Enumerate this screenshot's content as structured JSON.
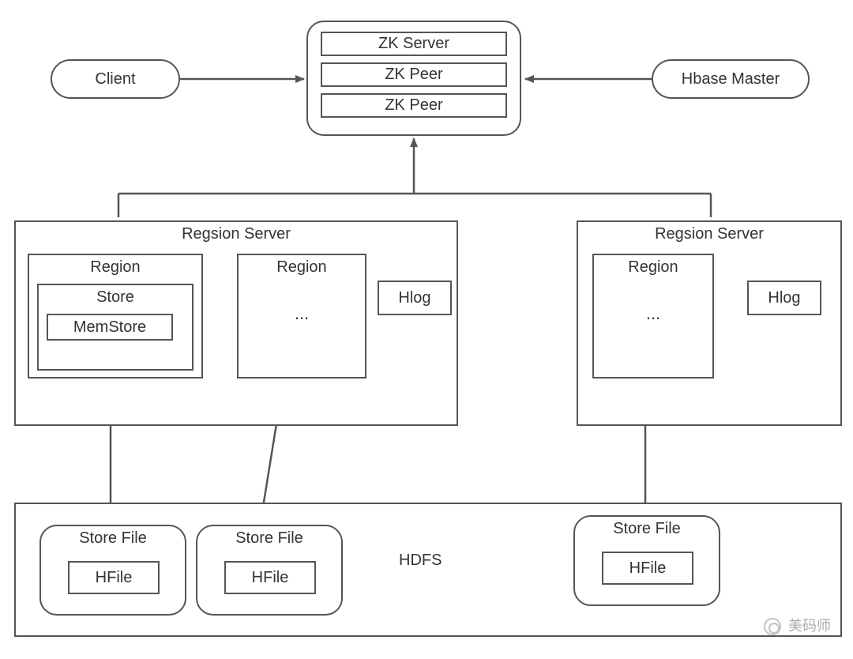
{
  "client": "Client",
  "hbase_master": "Hbase Master",
  "zk_cluster": {
    "items": [
      "ZK Server",
      "ZK Peer",
      "ZK Peer"
    ]
  },
  "region_server_1": {
    "title": "Regsion Server",
    "region_full": {
      "title": "Region",
      "store": "Store",
      "memstore": "MemStore"
    },
    "region_ellipsis": {
      "title": "Region",
      "body": "..."
    },
    "hlog": "Hlog"
  },
  "region_server_2": {
    "title": "Regsion Server",
    "region_ellipsis": {
      "body": "..."
    },
    "hlog": "Hlog"
  },
  "hdfs": {
    "label": "HDFS",
    "store_files": [
      {
        "title": "Store File",
        "hfile": "HFile"
      },
      {
        "title": "Store File",
        "hfile": "HFile"
      },
      {
        "title": "Store File",
        "hfile": "HFile"
      }
    ]
  },
  "watermark": "美码师"
}
